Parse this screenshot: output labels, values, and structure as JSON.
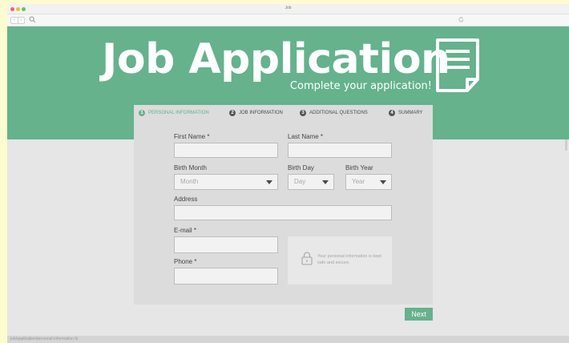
{
  "window": {
    "title": "Job"
  },
  "hero": {
    "title": "Job Application",
    "subtitle": "Complete your application!",
    "icon": "document-icon",
    "color": "#65b28d"
  },
  "steps": [
    {
      "number": "1",
      "label": "PERSONAL INFORMATION",
      "active": true
    },
    {
      "number": "2",
      "label": "JOB INFORMATION",
      "active": false
    },
    {
      "number": "3",
      "label": "ADDITIONAL QUESTIONS",
      "active": false
    },
    {
      "number": "4",
      "label": "SUMMARY",
      "active": false
    }
  ],
  "form": {
    "first_name_label": "First Name *",
    "last_name_label": "Last Name *",
    "birth_month_label": "Birth Month",
    "birth_month_value": "Month",
    "birth_day_label": "Birth Day",
    "birth_day_value": "Day",
    "birth_year_label": "Birth Year",
    "birth_year_value": "Year",
    "address_label": "Address",
    "email_label": "E-mail *",
    "phone_label": "Phone *",
    "secure_note": "Your personal information is kept safe and secure.",
    "next_label": "Next"
  },
  "status": {
    "url": "job/application/personal-information.fs"
  }
}
